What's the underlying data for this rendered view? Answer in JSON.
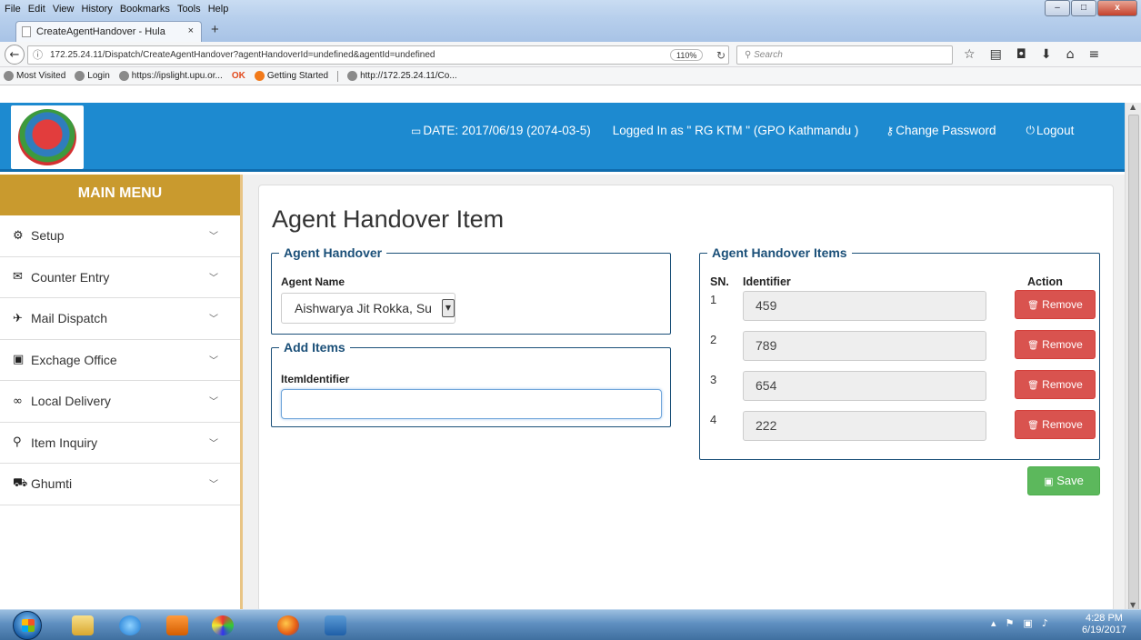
{
  "browser": {
    "menu": [
      "File",
      "Edit",
      "View",
      "History",
      "Bookmarks",
      "Tools",
      "Help"
    ],
    "tab_title": "CreateAgentHandover - Hula",
    "tab_close": "×",
    "new_tab": "+",
    "url": "172.25.24.11/Dispatch/CreateAgentHandover?agentHandoverId=undefined&agentId=undefined",
    "zoom": "110%",
    "search_placeholder": "Search",
    "bookmarks": [
      "Most Visited",
      "Login",
      "https://ipslight.upu.or...",
      "Getting Started",
      "http://172.25.24.11/Co..."
    ]
  },
  "header": {
    "date": "DATE: 2017/06/19 (2074-03-5)",
    "logged_in": "Logged In as \" RG KTM \" (GPO Kathmandu )",
    "change_password": "Change Password",
    "logout": "Logout"
  },
  "sidebar": {
    "title": "MAIN MENU",
    "items": [
      {
        "label": "Setup",
        "icon": "cogs-icon"
      },
      {
        "label": "Counter Entry",
        "icon": "envelope-icon"
      },
      {
        "label": "Mail Dispatch",
        "icon": "plane-icon"
      },
      {
        "label": "Exchage Office",
        "icon": "briefcase-icon"
      },
      {
        "label": "Local Delivery",
        "icon": "bicycle-icon"
      },
      {
        "label": "Item Inquiry",
        "icon": "search-icon"
      },
      {
        "label": "Ghumti",
        "icon": "car-icon"
      }
    ]
  },
  "main": {
    "page_title": "Agent Handover Item",
    "agent_section": {
      "legend": "Agent Handover",
      "agent_label": "Agent Name",
      "agent_value": "Aishwarya Jit Rokka, Su"
    },
    "add_section": {
      "legend": "Add Items",
      "identifier_label": "ItemIdentifier",
      "identifier_value": ""
    },
    "items_section": {
      "legend": "Agent Handover Items",
      "col_sn": "SN.",
      "col_identifier": "Identifier",
      "col_action": "Action",
      "rows": [
        {
          "sn": "1",
          "identifier": "459"
        },
        {
          "sn": "2",
          "identifier": "789"
        },
        {
          "sn": "3",
          "identifier": "654"
        },
        {
          "sn": "4",
          "identifier": "222"
        }
      ],
      "remove_label": "Remove"
    },
    "save_label": "Save"
  },
  "taskbar": {
    "time": "4:28 PM",
    "date": "6/19/2017"
  },
  "colors": {
    "header_blue": "#1d8ad0",
    "menu_gold": "#c99a2e",
    "remove_red": "#d9534f",
    "save_green": "#5cb85c",
    "legend_navy": "#1a4f78"
  }
}
